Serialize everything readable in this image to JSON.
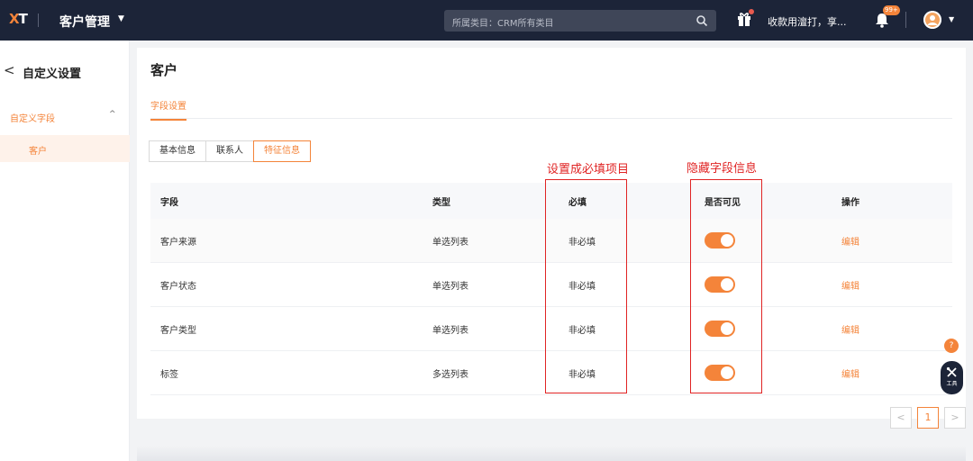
{
  "topbar": {
    "logo": "XT",
    "app_title": "客户管理",
    "search_text": "所属类目：CRM所有类目",
    "promo_text": "收款用澶打，享...",
    "bell_badge": "99+"
  },
  "sidebar": {
    "title": "自定义设置",
    "group_label": "自定义字段",
    "active_item": "客户"
  },
  "main": {
    "page_title": "客户",
    "tab": "字段设置",
    "segments": [
      "基本信息",
      "联系人",
      "特征信息"
    ],
    "active_segment": "特征信息",
    "table": {
      "headers": [
        "字段",
        "类型",
        "必填",
        "是否可见",
        "操作"
      ],
      "rows": [
        {
          "field": "客户来源",
          "type": "单选列表",
          "required": "非必填",
          "visible": true,
          "action": "编辑"
        },
        {
          "field": "客户状态",
          "type": "单选列表",
          "required": "非必填",
          "visible": true,
          "action": "编辑"
        },
        {
          "field": "客户类型",
          "type": "单选列表",
          "required": "非必填",
          "visible": true,
          "action": "编辑"
        },
        {
          "field": "标签",
          "type": "多选列表",
          "required": "非必填",
          "visible": true,
          "action": "编辑"
        }
      ]
    },
    "pagination": {
      "prev": "<",
      "current": "1",
      "next": ">"
    }
  },
  "annotations": {
    "required_note": "设置成必填项目",
    "hidden_note": "隐藏字段信息"
  },
  "float_tools": {
    "help": "?",
    "tools_label": "工具"
  },
  "colors": {
    "accent": "#f4843a",
    "topbar": "#1c2438",
    "annotation": "#e02424"
  }
}
